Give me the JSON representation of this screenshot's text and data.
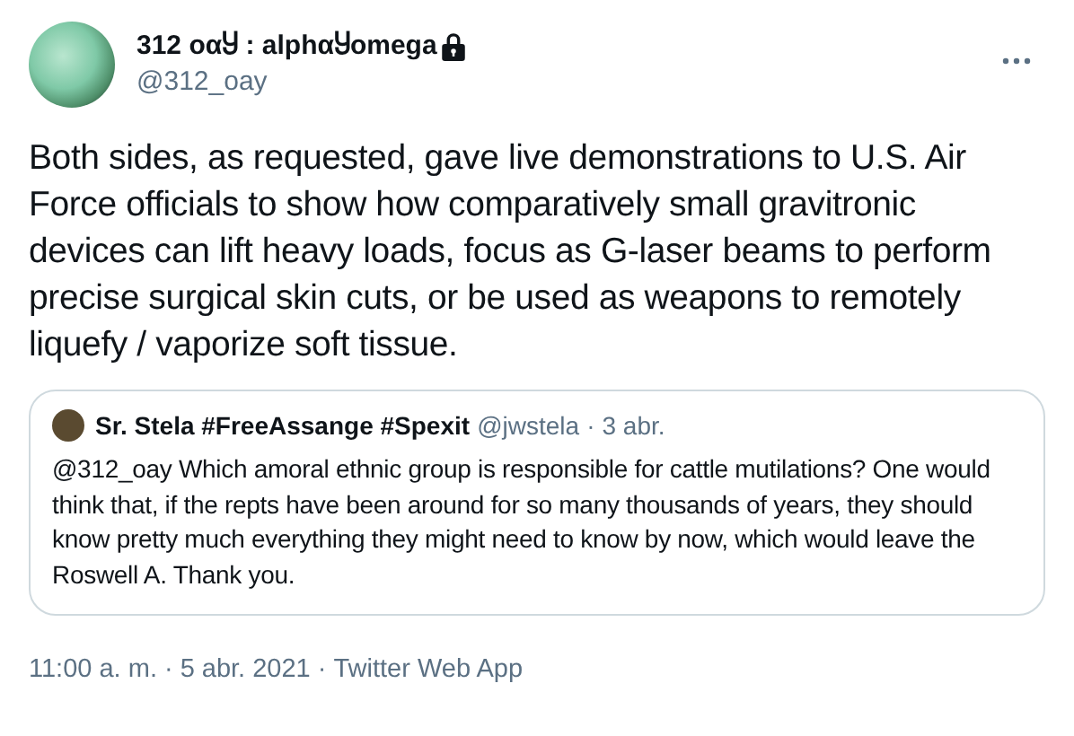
{
  "author": {
    "name": "312 oαႸ : alphαႸomega",
    "handle": "@312_oay",
    "protected": true
  },
  "text": "Both sides, as requested, gave live demonstrations to U.S. Air Force officials to show how comparatively small gravitronic devices can lift heavy loads, focus as G-laser beams to perform precise surgical skin cuts, or be used as weapons to remotely liquefy / vaporize soft tissue.",
  "quote": {
    "name": "Sr. Stela #FreeAssange #Spexit",
    "handle": "@jwstela",
    "separator": "·",
    "date": "3 abr.",
    "mention": "@312_oay",
    "text": "Which amoral ethnic group is responsible for cattle mutilations? One would think that, if the repts have been around for so many thousands of years, they should know pretty much everything they might need to know by now, which would leave the Roswell A. Thank you."
  },
  "meta": {
    "time": "11:00 a. m.",
    "separator_1": "·",
    "date": "5 abr. 2021",
    "separator_2": "·",
    "source": "Twitter Web App"
  }
}
